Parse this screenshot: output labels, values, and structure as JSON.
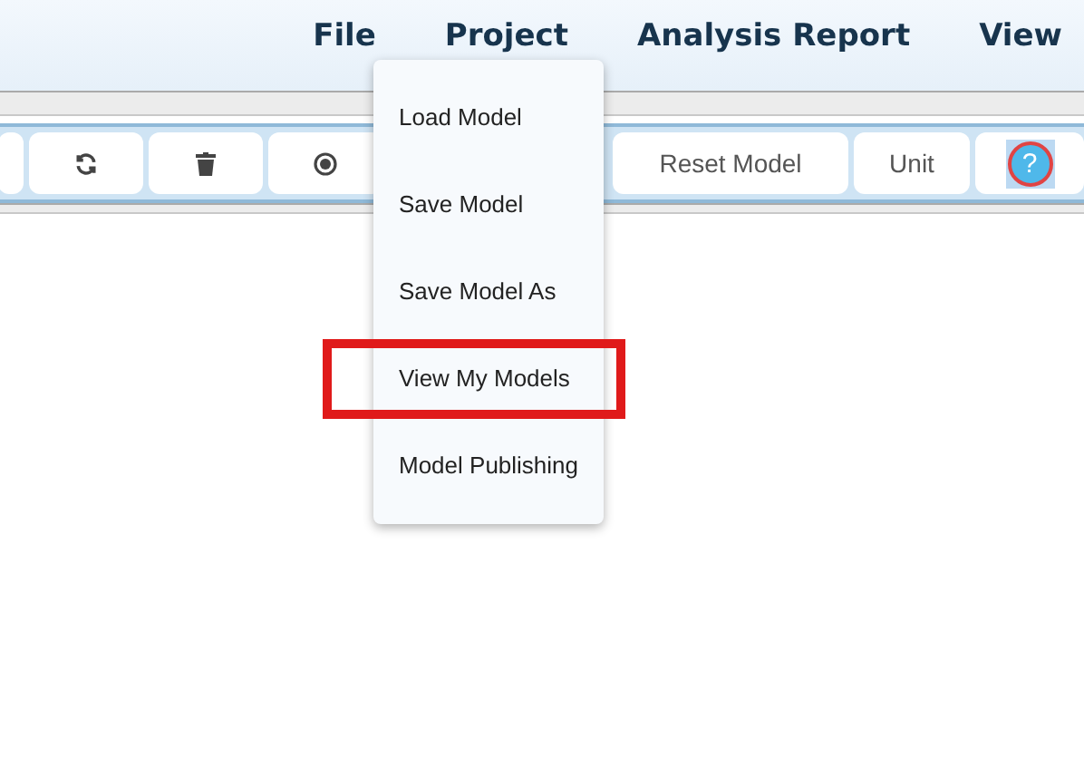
{
  "menu_bar": [
    {
      "label": "File"
    },
    {
      "label": "Project"
    },
    {
      "label": "Analysis Report"
    },
    {
      "label": "View"
    }
  ],
  "toolbar": {
    "left": [
      {
        "kind": "blank"
      },
      {
        "kind": "refresh"
      },
      {
        "kind": "delete"
      },
      {
        "kind": "record"
      }
    ],
    "right": [
      {
        "kind": "text",
        "label": "Reset Model"
      },
      {
        "kind": "text",
        "label": "Unit"
      },
      {
        "kind": "help",
        "label": "?",
        "selected": true
      }
    ]
  },
  "dropdown": {
    "items": [
      {
        "label": "Load Model",
        "highlighted": false
      },
      {
        "label": "Save Model",
        "highlighted": false
      },
      {
        "label": "Save Model As",
        "highlighted": false
      },
      {
        "label": "View My Models",
        "highlighted": true
      },
      {
        "label": "Model Publishing",
        "highlighted": false
      }
    ]
  }
}
